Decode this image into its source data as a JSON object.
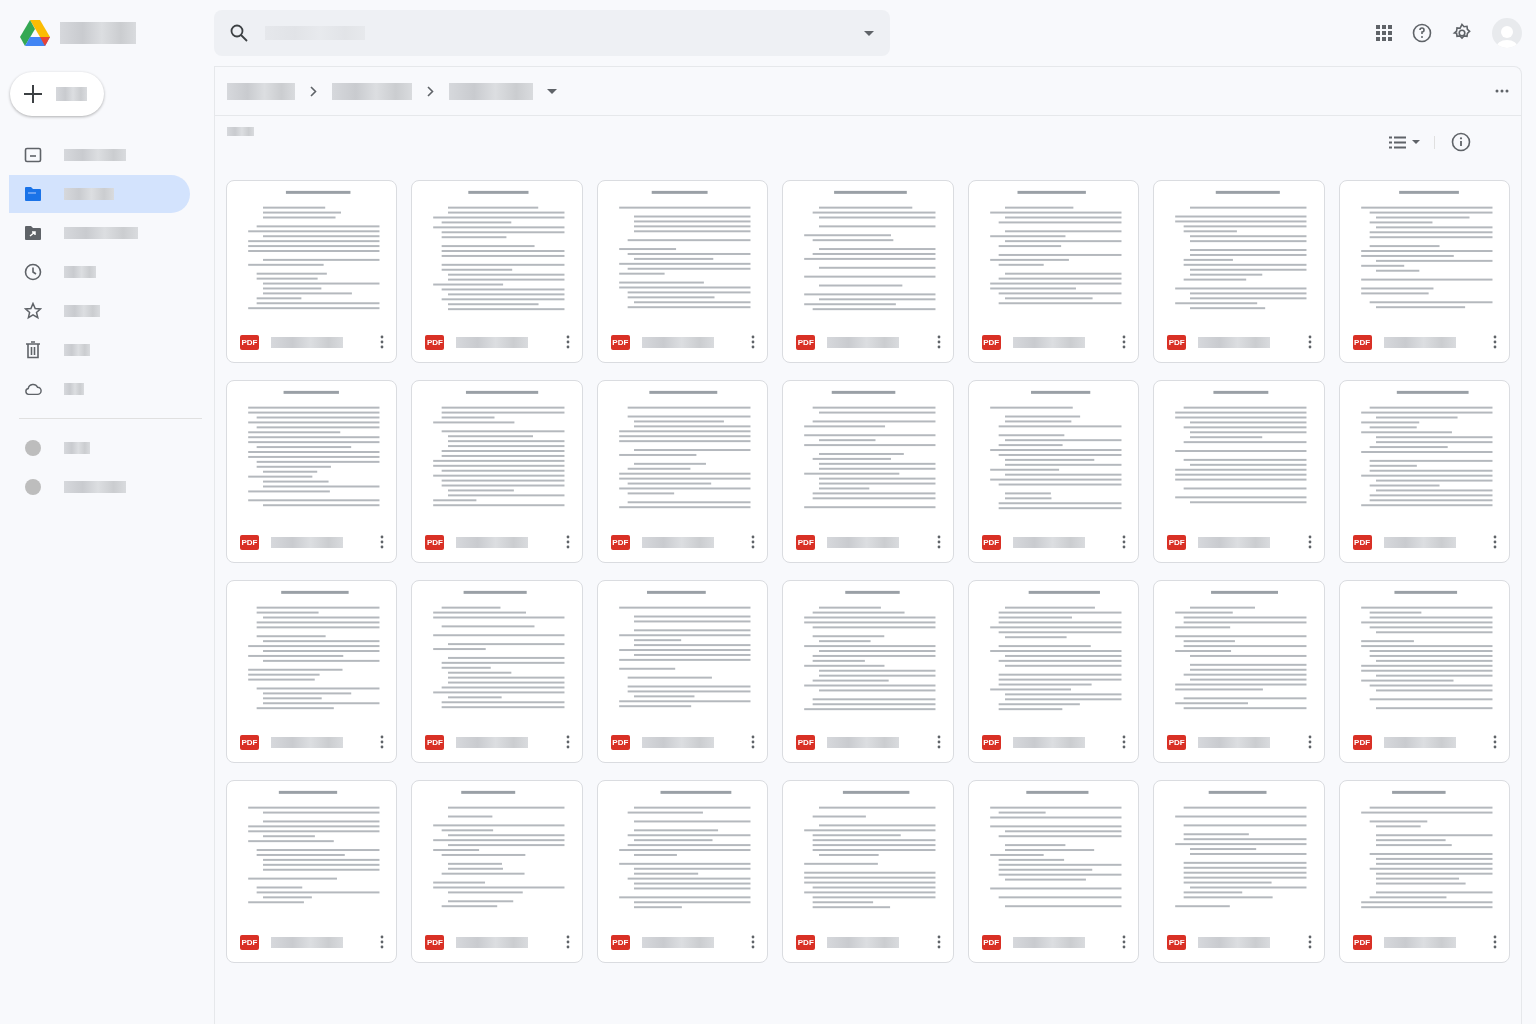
{
  "sidebar": {
    "items": [
      {
        "kind": "computers",
        "selected": false
      },
      {
        "kind": "drive",
        "selected": true
      },
      {
        "kind": "shared",
        "selected": false
      },
      {
        "kind": "recent",
        "selected": false
      },
      {
        "kind": "starred",
        "selected": false
      },
      {
        "kind": "trash",
        "selected": false
      },
      {
        "kind": "storage",
        "selected": false
      },
      {
        "kind": "dot",
        "selected": false
      },
      {
        "kind": "dot",
        "selected": false
      }
    ]
  },
  "breadcrumbs": [
    {
      "kind": "crumb"
    },
    {
      "kind": "crumb"
    },
    {
      "kind": "current"
    }
  ],
  "files": [
    {
      "badge": "PDF"
    },
    {
      "badge": "PDF"
    },
    {
      "badge": "PDF"
    },
    {
      "badge": "PDF"
    },
    {
      "badge": "PDF"
    },
    {
      "badge": "PDF"
    },
    {
      "badge": "PDF"
    },
    {
      "badge": "PDF"
    },
    {
      "badge": "PDF"
    },
    {
      "badge": "PDF"
    },
    {
      "badge": "PDF"
    },
    {
      "badge": "PDF"
    },
    {
      "badge": "PDF"
    },
    {
      "badge": "PDF"
    },
    {
      "badge": "PDF"
    },
    {
      "badge": "PDF"
    },
    {
      "badge": "PDF"
    },
    {
      "badge": "PDF"
    },
    {
      "badge": "PDF"
    },
    {
      "badge": "PDF"
    },
    {
      "badge": "PDF"
    },
    {
      "badge": "PDF"
    },
    {
      "badge": "PDF"
    },
    {
      "badge": "PDF"
    },
    {
      "badge": "PDF"
    },
    {
      "badge": "PDF"
    },
    {
      "badge": "PDF"
    },
    {
      "badge": "PDF"
    }
  ]
}
